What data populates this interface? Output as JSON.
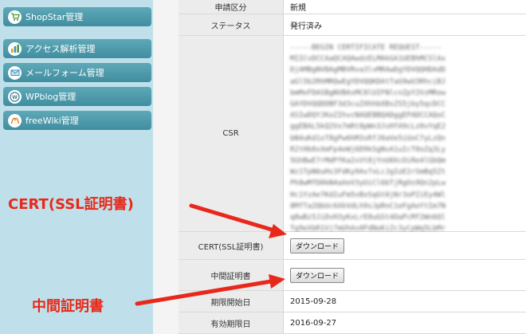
{
  "sidebar": {
    "items": [
      {
        "label": "ShopStar管理",
        "icon": "shopstar-cart-icon"
      },
      {
        "label": "アクセス解析管理",
        "icon": "analytics-icon"
      },
      {
        "label": "メールフォーム管理",
        "icon": "mail-icon"
      },
      {
        "label": "WPblog管理",
        "icon": "wordpress-icon"
      },
      {
        "label": "freeWiki管理",
        "icon": "wiki-icon"
      }
    ]
  },
  "table": {
    "application_type": {
      "label": "申請区分",
      "value": "新規"
    },
    "status": {
      "label": "ステータス",
      "value": "発行済み"
    },
    "csr": {
      "label": "CSR",
      "value": "-----BEGIN CERTIFICATE REQUEST-----\nMIICvDCCAaQCAQAwdzELMAkGA1UEBhMCSlAx\nDjAMBgNVBAgMBVRva3lvMRAwDgYDVQQHDAdD\naGl5b2RhMRQwEgYDVQQKDAtTaG9wU3RhciBJ\nbmMxFDASBgNVBAsMC0lUIFNlcnZpY2VzMRow\nGAYDVQQDDBF3d3cuZXhhbXBsZS5jby5qcDCC\nASIwDQYJKoZIhvcNAQEBBQADggEPADCCAQoC\nggEBAL5kQ2Vx7mRt8pWn3JsHfA9cLz0vYqE2\nbN4uKd1xT8gPw6hM3sRfJ0aVe5iUoC7yLzQn\nR2tHb8xXmFp4eWj6D9kSgNvA1uIcT0oZq3Ly\n5GhBwE7rMdPfKa2sVt8jYnU0XcOiRe4lGbQm\nWz1TpN6uHs3FdKy9Av7xLcJgIoE2rSmBq5Zt\nPh8wMfD0kN4aXeV3yUiCl6bTjRgOs9Qn2pLw\nHc1YzAe7KdIuFm5vBxSqGt0jNr3oPZiEy4Wl\n8MfTa2QbUc6XkVdLh9sJpRnC1eFgAoYtIm7N\nq0wBz5JiDvH3yKxLrE8uGSt4OaPcMf2Wn6Ql\nTg9eXbR1Vj7mUhAs0FdNoKiZc3yCpWq5LbMr\nE2vIaYOhG4nDt8sJfPkx1uQwRz6SmBlT9cVe\nAgMBAAGgADANBgkqhkiG9w0BAQsFAAOCAQEA\n-----END CERTIFICATE REQUEST-----"
    },
    "cert": {
      "label": "CERT(SSL証明書)",
      "button": "ダウンロード"
    },
    "intermediate": {
      "label": "中間証明書",
      "button": "ダウンロード"
    },
    "start_date": {
      "label": "期限開始日",
      "value": "2015-09-28"
    },
    "end_date": {
      "label": "有効期限日",
      "value": "2016-09-27"
    }
  },
  "annotations": {
    "cert": "CERT(SSL証明書)",
    "intermediate": "中間証明書",
    "color": "#e8281a"
  },
  "colors": {
    "sidebar_bg": "#bfe0ea",
    "nav_button": "#4a98aa"
  }
}
